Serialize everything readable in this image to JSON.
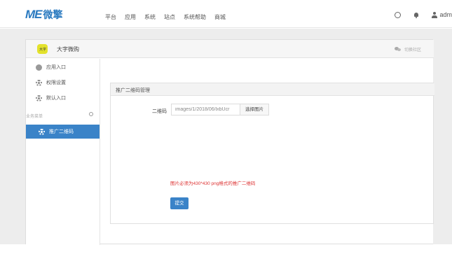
{
  "brand": {
    "mark": "ME",
    "name": "微擎"
  },
  "nav": [
    "平台",
    "应用",
    "系统",
    "站点",
    "系统帮助",
    "商城"
  ],
  "header": {
    "user_name": "adm"
  },
  "app": {
    "avatar_text": "大字",
    "name": "大字微购",
    "community_label": "切换社区"
  },
  "sidebar": {
    "items": [
      {
        "label": "应用入口",
        "icon": "circle-icon"
      },
      {
        "label": "权限设置",
        "icon": "gear-icon"
      },
      {
        "label": "默认入口",
        "icon": "gear-icon"
      }
    ],
    "section_title": "业务菜单",
    "active_item": {
      "label": "推广二维码",
      "icon": "gear-icon"
    }
  },
  "content": {
    "title": "推广二维码管理",
    "qr_label": "二维码",
    "qr_value": "images/1/2018/06/lxbUcr",
    "choose_button": "选择图片",
    "warning": "图片必须为430*430 png格式的推广二维码",
    "submit_button": "提交"
  },
  "colors": {
    "brand": "#2a7ac0",
    "active": "#3a83c8",
    "warning": "#dd3333"
  }
}
